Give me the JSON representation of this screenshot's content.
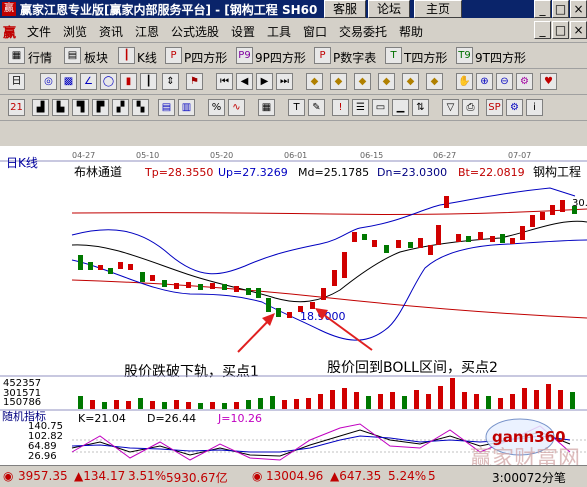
{
  "titlebar": {
    "title": "赢家江恩专业版[赢家内部服务平台] - [钢构工程 SH60",
    "buttons": [
      "客服",
      "论坛",
      "主页"
    ],
    "win_controls": [
      "_",
      "□",
      "×"
    ]
  },
  "menubar": {
    "logo": "赢",
    "items": [
      "文件",
      "浏览",
      "资讯",
      "江恩",
      "公式选股",
      "设置",
      "工具",
      "窗口",
      "交易委托",
      "帮助"
    ],
    "win_controls": [
      "_",
      "□",
      "×"
    ]
  },
  "toolbar1": {
    "items": [
      "行情",
      "板块",
      "K线",
      "P四方形",
      "9P四方形",
      "P数字表",
      "T四方形",
      "9T四方形"
    ]
  },
  "chart_header": {
    "period_label": "日K线",
    "dates": [
      "04-27",
      "05-10",
      "05-20",
      "06-01",
      "06-15",
      "06-27",
      "07-07"
    ],
    "indicator": "布林通道",
    "tp": "Tp=28.3550",
    "up": "Up=27.3269",
    "md": "Md=25.1785",
    "dn": "Dn=23.0300",
    "bt": "Bt=22.0819",
    "stock_name": "钢构工程",
    "top_price_label": "30."
  },
  "annotations": {
    "low_price": "18.9000",
    "buy1": "股价跌破下轨，买点1",
    "buy2": "股价回到BOLL区间，买点2"
  },
  "volume_axis": [
    "452357",
    "301571",
    "150786"
  ],
  "kdj": {
    "title": "随机指标",
    "k": "K=21.04",
    "d": "D=26.44",
    "j": "J=10.26",
    "axis": [
      "140.75",
      "102.82",
      "64.89",
      "26.96"
    ]
  },
  "watermark": {
    "site": "gann360",
    "big": "赢家财富网"
  },
  "status": {
    "sh_value": "3957.35",
    "sh_change": "▲134.17",
    "sh_pct": "3.51%",
    "sh_amount": "5930.67亿",
    "sz_value": "13004.96",
    "sz_change": "▲647.35",
    "sz_pct": "5.24%",
    "sz_amount": "5",
    "time": "3:00072分笔"
  },
  "colors": {
    "up_candle": "#d00000",
    "down_candle": "#007800",
    "boll_upper": "#0000cc",
    "boll_mid": "#000000",
    "boll_lower": "#0000cc",
    "long_ma": "#c00000",
    "arrow": "#e02020",
    "up_text": "#c00000",
    "down_text": "#009000"
  }
}
